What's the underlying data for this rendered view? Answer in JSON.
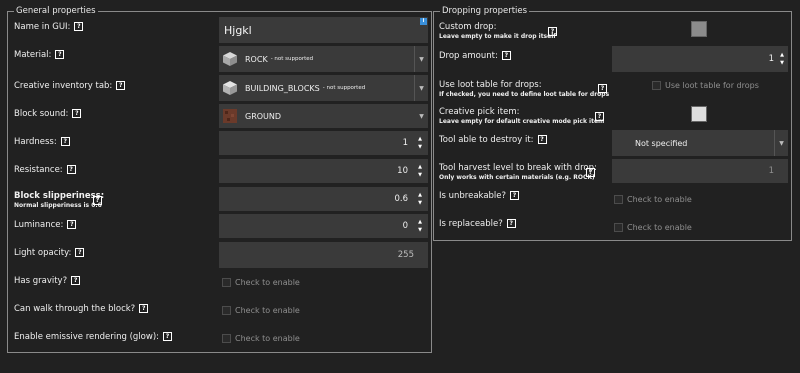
{
  "general": {
    "legend": "General properties",
    "name_label": "Name in GUI:",
    "name_value": "Hjgkl",
    "name_info_icon": "info-icon",
    "material_label": "Material:",
    "material_value": "ROCK",
    "material_note": "- not supported",
    "creative_tab_label": "Creative inventory tab:",
    "creative_tab_value": "BUILDING_BLOCKS",
    "creative_tab_note": "- not supported",
    "sound_label": "Block sound:",
    "sound_value": "GROUND",
    "hardness_label": "Hardness:",
    "hardness_value": "1",
    "resistance_label": "Resistance:",
    "resistance_value": "10",
    "slipperiness_label": "Block slipperiness:",
    "slipperiness_sub": "Normal slipperiness is 0.6",
    "slipperiness_value": "0.6",
    "luminance_label": "Luminance:",
    "luminance_value": "0",
    "opacity_label": "Light opacity:",
    "opacity_value": "255",
    "gravity_label": "Has gravity?",
    "walkthrough_label": "Can walk through the block?",
    "emissive_label": "Enable emissive rendering (glow):",
    "check_to_enable": "Check to enable"
  },
  "dropping": {
    "legend": "Dropping properties",
    "custom_drop_label": "Custom drop:",
    "custom_drop_sub": "Leave empty to make it drop itself",
    "drop_amount_label": "Drop amount:",
    "drop_amount_value": "1",
    "loot_table_label": "Use loot table for drops:",
    "loot_table_sub": "If checked, you need to define loot table for drops",
    "loot_table_check": "Use loot table for drops",
    "pick_item_label": "Creative pick item:",
    "pick_item_sub": "Leave empty for default creative mode pick item",
    "tool_label": "Tool able to destroy it:",
    "tool_value": "Not specified",
    "harvest_label": "Tool harvest level to break with drop:",
    "harvest_sub": "Only works with certain materials (e.g. ROCK)",
    "harvest_value": "1",
    "unbreakable_label": "Is unbreakable?",
    "replaceable_label": "Is replaceable?",
    "check_to_enable": "Check to enable"
  },
  "help_glyph": "?",
  "colors": {
    "background": "#212121",
    "field": "#3a3a3a",
    "border": "#8a8a8a",
    "accent_info": "#3a8fd9"
  }
}
